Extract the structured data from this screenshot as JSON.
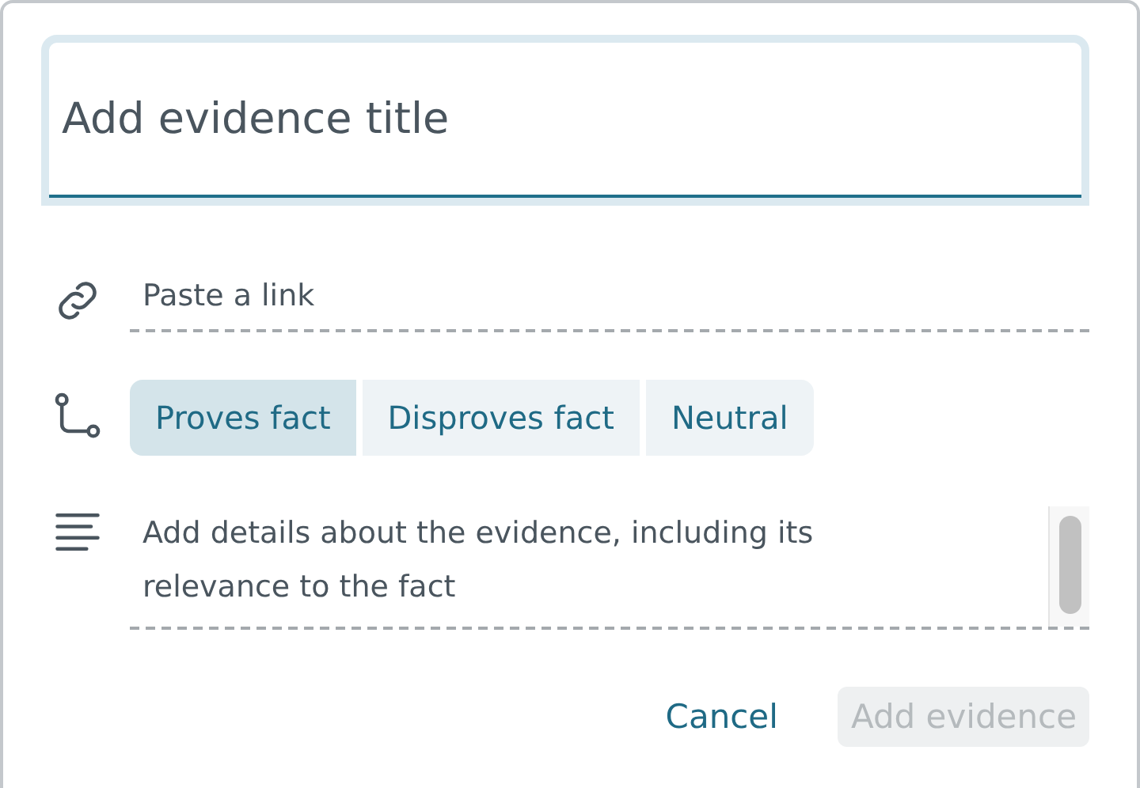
{
  "title_field": {
    "placeholder": "Add evidence title",
    "focused": true
  },
  "link_field": {
    "placeholder": "Paste a link"
  },
  "relation": [
    {
      "label": "Proves fact",
      "selected": true
    },
    {
      "label": "Disproves fact",
      "selected": false
    },
    {
      "label": "Neutral",
      "selected": false
    }
  ],
  "details_field": {
    "placeholder": "Add details about the evidence, including its relevance to the fact"
  },
  "buttons": [
    {
      "label": "Cancel",
      "kind": "link",
      "disabled": false
    },
    {
      "label": "Add evidence",
      "kind": "primary",
      "disabled": true
    }
  ]
}
